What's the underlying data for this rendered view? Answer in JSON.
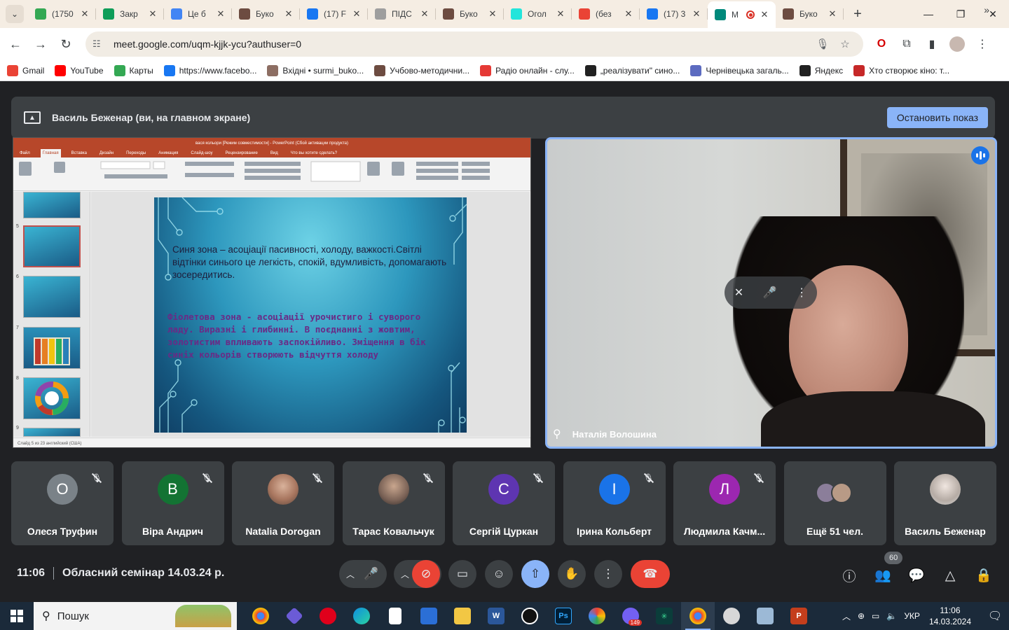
{
  "browser": {
    "tabs": [
      {
        "label": "(1750",
        "icon": "sheets-icon",
        "color": "#34a853"
      },
      {
        "label": "Закр",
        "icon": "plus-doc-icon",
        "color": "#0f9d58"
      },
      {
        "label": "Це б",
        "icon": "k-icon",
        "color": "#4285f4"
      },
      {
        "label": "Буко",
        "icon": "gear-site-icon",
        "color": "#6d4c41"
      },
      {
        "label": "(17) F",
        "icon": "facebook-icon",
        "color": "#1877f2"
      },
      {
        "label": "ПІДС",
        "icon": "spiral-icon",
        "color": "#9e9e9e"
      },
      {
        "label": "Буко",
        "icon": "gear-site-icon",
        "color": "#6d4c41"
      },
      {
        "label": "Огол",
        "icon": "olx-icon",
        "color": "#23e5db"
      },
      {
        "label": "(без",
        "icon": "gmail-icon",
        "color": "#ea4335"
      },
      {
        "label": "(17) 3",
        "icon": "facebook-icon",
        "color": "#1877f2"
      },
      {
        "label": "M",
        "icon": "meet-icon",
        "color": "#00897b"
      },
      {
        "label": "Буко",
        "icon": "gear-site-icon",
        "color": "#6d4c41"
      }
    ],
    "url": "meet.google.com/uqm-kjjk-ycu?authuser=0",
    "bookmarks": [
      {
        "label": "Gmail",
        "color": "#ea4335",
        "icon": "gmail-icon"
      },
      {
        "label": "YouTube",
        "color": "#ff0000",
        "icon": "youtube-icon"
      },
      {
        "label": "Карты",
        "color": "#34a853",
        "icon": "maps-pin-icon"
      },
      {
        "label": "https://www.facebo...",
        "color": "#1877f2",
        "icon": "facebook-icon"
      },
      {
        "label": "Вхідні • surmi_buko...",
        "color": "#8d6e63",
        "icon": "mail-icon"
      },
      {
        "label": "Учбово-методични...",
        "color": "#6d4c41",
        "icon": "gear-site-icon"
      },
      {
        "label": "Радіо онлайн - слу...",
        "color": "#e53935",
        "icon": "radio-icon"
      },
      {
        "label": "„реалізувати\" сино...",
        "color": "#212121",
        "icon": "globe-icon"
      },
      {
        "label": "Чернівецька загаль...",
        "color": "#5c6bc0",
        "icon": "drop-icon"
      },
      {
        "label": "Яндекс",
        "color": "#212121",
        "icon": "globe-icon"
      },
      {
        "label": "Хто створює кіно: т...",
        "color": "#c62828",
        "icon": "film-icon"
      }
    ]
  },
  "meet": {
    "banner_text": "Василь Беженар (ви, на главном экране)",
    "stop_button": "Остановить показ",
    "ppt": {
      "title": "вася кольори [Режим совместимости] - PowerPoint (Сбой активации продукта)",
      "tabs": [
        "Файл",
        "Главная",
        "Вставка",
        "Дизайн",
        "Переходы",
        "Анимация",
        "Слайд-шоу",
        "Рецензирование",
        "Вид",
        "Что вы хотите сделать?"
      ],
      "status": "Слайд 5 из 23    английский (США)",
      "thumb_numbers": [
        "5",
        "6",
        "7",
        "8",
        "9"
      ],
      "slide_text_1": "Синя зона – асоціації пасивності, холоду, важкості.Світлі відтінки синього це легкість, спокій, вдумливість, допомагають зосередитись.",
      "slide_text_2": "Фіолетова зона - асоціації урочистиго і суворого ладу. Виразні і глибинні. В поєднанні з жовтим, золотистим впливають заспокійливо. Зміщення в бік синіх кольорів створюють відчуття  холоду"
    },
    "speaker_name": "Наталія Волошина",
    "participants": [
      {
        "name": "Олеся Труфин",
        "initial": "О",
        "color": "#7a8288"
      },
      {
        "name": "Віра Андрич",
        "initial": "В",
        "color": "#137333"
      },
      {
        "name": "Natalia Dorogan",
        "initial": "",
        "color": ""
      },
      {
        "name": "Тарас Ковальчук",
        "initial": "",
        "color": ""
      },
      {
        "name": "Сергій Цуркан",
        "initial": "С",
        "color": "#5e35b1"
      },
      {
        "name": "Ірина Кольберт",
        "initial": "І",
        "color": "#1a73e8"
      },
      {
        "name": "Людмила Качм...",
        "initial": "Л",
        "color": "#9c27b0"
      },
      {
        "name": "Ещё 51 чел.",
        "initial": "",
        "color": ""
      },
      {
        "name": "Василь Беженар",
        "initial": "",
        "color": ""
      }
    ],
    "clock": "11:06",
    "meeting_title": "Обласний семінар 14.03.24 р.",
    "participant_count": "60"
  },
  "taskbar": {
    "search_placeholder": "Пошук",
    "viber_badge": "149",
    "language": "УКР",
    "time": "11:06",
    "date": "14.03.2024"
  }
}
